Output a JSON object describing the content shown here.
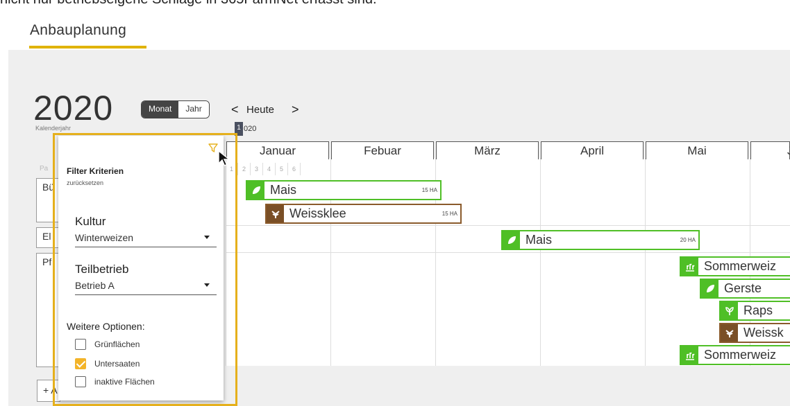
{
  "header": {
    "cut_text": "nicht nur betriebseigene Schläge in 365FarmNet erfasst sind.",
    "page_title": "Anbauplanung"
  },
  "calendar": {
    "year": "2020",
    "year_caption": "Kalenderjahr",
    "view_toggle": {
      "month_label": "Monat",
      "year_label": "Jahr",
      "active": "Monat"
    },
    "nav": {
      "prev": "<",
      "today": "Heute",
      "next": ">"
    },
    "marker_day": "1",
    "year_suffix": "020",
    "months": [
      "Januar",
      "Febuar",
      "März",
      "April",
      "Mai",
      "J"
    ],
    "days": [
      "1",
      "2",
      "3",
      "4",
      "5",
      "6"
    ]
  },
  "fields_table": {
    "header": "Pa",
    "rows": [
      {
        "label": "Bü"
      },
      {
        "label": "El"
      },
      {
        "label": "Pf"
      }
    ],
    "add_label": "+ A"
  },
  "bars": [
    {
      "crop": "Mais",
      "area": "15 HA",
      "icon": "leaf-icon",
      "color": "#4fbf26"
    },
    {
      "crop": "Weissklee",
      "area": "15 HA",
      "icon": "clover-icon",
      "color": "#7a4f26"
    },
    {
      "crop": "Mais",
      "area": "20 HA",
      "icon": "leaf-icon",
      "color": "#4fbf26"
    },
    {
      "crop": "Sommerweiz",
      "area": "",
      "icon": "wheat-icon",
      "color": "#4fbf26"
    },
    {
      "crop": "Gerste",
      "area": "",
      "icon": "leaf-icon",
      "color": "#4fbf26"
    },
    {
      "crop": "Raps",
      "area": "",
      "icon": "sprout-icon",
      "color": "#4fbf26"
    },
    {
      "crop": "Weissk",
      "area": "",
      "icon": "clover-icon",
      "color": "#7a4f26"
    },
    {
      "crop": "Sommerweiz",
      "area": "",
      "icon": "wheat-icon",
      "color": "#4fbf26"
    }
  ],
  "filter": {
    "title": "Filter Kriterien",
    "reset": "zurücksetzen",
    "kultur_label": "Kultur",
    "kultur_value": "Winterweizen",
    "teilbetrieb_label": "Teilbetrieb",
    "teilbetrieb_value": "Betrieb A",
    "options_title": "Weitere Optionen:",
    "options": [
      {
        "label": "Grünflächen",
        "checked": false
      },
      {
        "label": "Untersaaten",
        "checked": true
      },
      {
        "label": "inaktive Flächen",
        "checked": false
      }
    ],
    "highlight_color": "#e5b01c",
    "checkbox_color": "#f3b429"
  }
}
